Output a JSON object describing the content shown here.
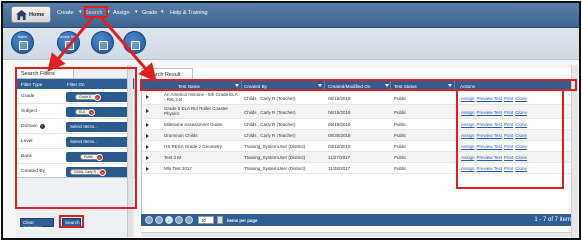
{
  "nav": {
    "home": "Home",
    "items": [
      "Create",
      "Search",
      "Assign",
      "Grade",
      "Help & Training"
    ]
  },
  "icons": [
    {
      "label": "Home",
      "icon": "home-icon"
    },
    {
      "label": "Recent Tests",
      "icon": "document-icon"
    },
    {
      "label": "",
      "icon": "document-icon"
    },
    {
      "label": "",
      "icon": "document-icon"
    }
  ],
  "filters": {
    "tab": "Search Filters",
    "col_type": "Filter Type",
    "col_on": "Filter On",
    "rows": [
      {
        "type": "Grade",
        "value": "Grade 8",
        "placeholder": ""
      },
      {
        "type": "Subject",
        "value": "ELA",
        "placeholder": ""
      },
      {
        "type": "Domain",
        "value": "",
        "placeholder": "Select Items..."
      },
      {
        "type": "Level",
        "value": "",
        "placeholder": "Select Items..."
      },
      {
        "type": "Bank",
        "value": "Public",
        "placeholder": ""
      },
      {
        "type": "Created By",
        "value": "Childs, Carly R",
        "placeholder": ""
      }
    ],
    "clear_label": "Clear Selection",
    "search_label": "Search"
  },
  "results": {
    "tab": "Search Result",
    "columns": [
      "Test Name",
      "Created By",
      "Created/Modified On",
      "Test Status",
      "Actions"
    ],
    "rows": [
      {
        "name": "An America Heroine - 5th Grade ELA - RI6, LI4",
        "by": "Childs , Carly R (Teacher)",
        "date": "06/15/2018",
        "status": "Public"
      },
      {
        "name": "Grade 8 ELA RI4 Roller Coaster Physics",
        "by": "Childs , Carly R (Teacher)",
        "date": "06/15/2018",
        "status": "Public"
      },
      {
        "name": "Milestone Assessment Guide",
        "by": "Childs , Carly R (Teacher)",
        "date": "06/15/2018",
        "status": "Public"
      },
      {
        "name": "Drummon Childs",
        "by": "Childs , Carly R (Teacher)",
        "date": "05/30/2018",
        "status": "Public"
      },
      {
        "name": "HS RESA Grade 2 Geometry",
        "by": "Training_SystemUser (District)",
        "date": "03/12/2018",
        "status": "Public"
      },
      {
        "name": "Test 3 M",
        "by": "Training_SystemUser (District)",
        "date": "11/27/2017",
        "status": "Public"
      },
      {
        "name": "Mlo Test 2017",
        "by": "Training_SystemUser (District)",
        "date": "11/28/2017",
        "status": "Public"
      }
    ],
    "actions": [
      "Assign",
      "Preview Test",
      "Print",
      "Clone"
    ],
    "pager": {
      "current": "1",
      "page_size": "10",
      "items_per_page": "items per page",
      "count": "1 - 7 of 7 items"
    }
  },
  "colors": {
    "accent": "#2f5f92",
    "highlight": "#e02020"
  }
}
